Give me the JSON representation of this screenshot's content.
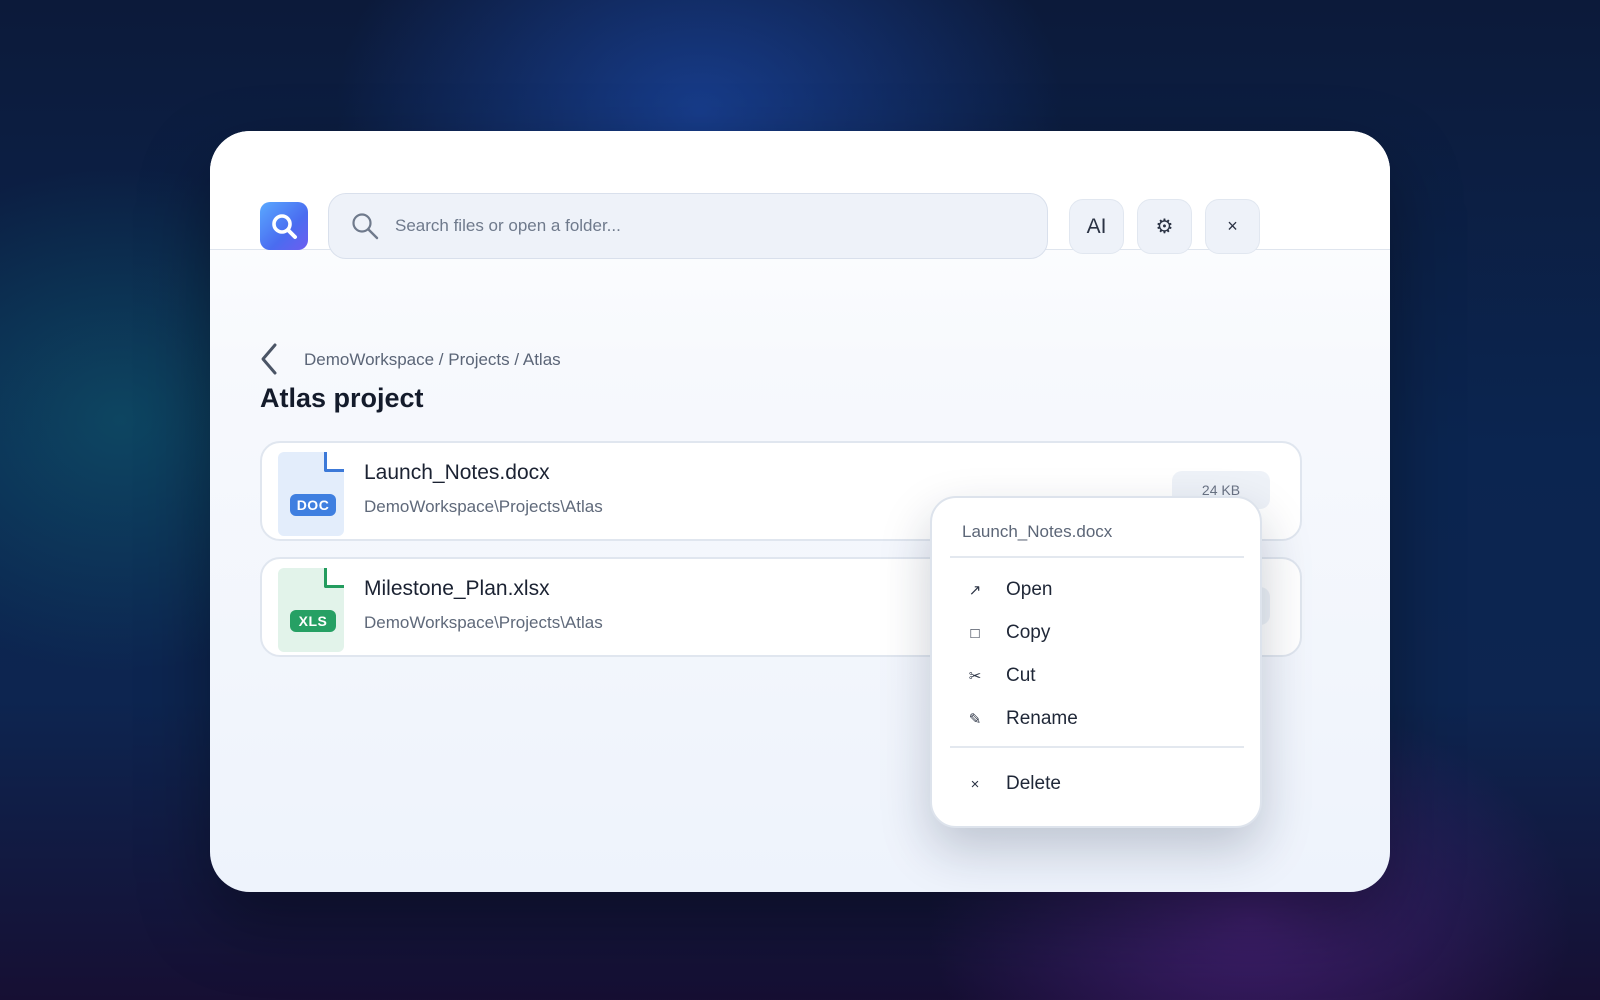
{
  "topbar": {
    "search_placeholder": "Search files or open a folder...",
    "ai_label": "AI",
    "settings_glyph": "⚙",
    "close_glyph": "×"
  },
  "breadcrumb": "DemoWorkspace / Projects / Atlas",
  "page_title": "Atlas project",
  "files": [
    {
      "name": "Launch_Notes.docx",
      "path": "DemoWorkspace\\Projects\\Atlas",
      "type_badge": "DOC",
      "size": "24 KB"
    },
    {
      "name": "Milestone_Plan.xlsx",
      "path": "DemoWorkspace\\Projects\\Atlas",
      "type_badge": "XLS",
      "size": ""
    }
  ],
  "context_menu": {
    "title": "Launch_Notes.docx",
    "items": [
      {
        "label": "Open",
        "icon": "open-external-icon",
        "glyph": "↗"
      },
      {
        "label": "Copy",
        "icon": "copy-icon",
        "glyph": "□"
      },
      {
        "label": "Cut",
        "icon": "scissors-icon",
        "glyph": "✂"
      },
      {
        "label": "Rename",
        "icon": "pencil-icon",
        "glyph": "✎"
      },
      {
        "label": "Delete",
        "icon": "close-icon",
        "glyph": "×"
      }
    ]
  },
  "colors": {
    "accent": "#4a6cf0",
    "doc_badge": "#3f7fe0",
    "xls_badge": "#26a064"
  }
}
